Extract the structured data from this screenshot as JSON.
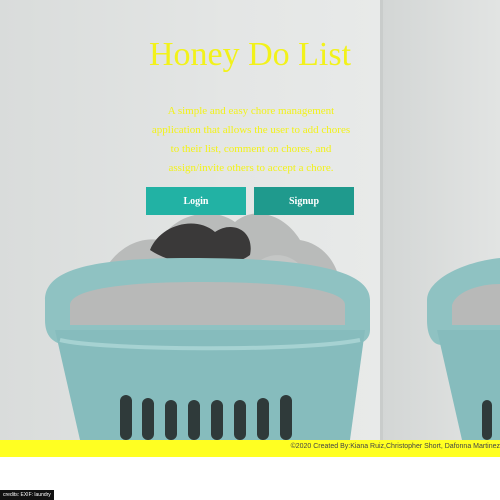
{
  "app": {
    "title": "Honey Do List",
    "description": "A simple and easy chore management application that allows the user to add chores to their list, comment on chores, and assign/invite others to accept a chore."
  },
  "actions": {
    "login_label": "Login",
    "signup_label": "Signup"
  },
  "footer": {
    "text": "©2020 Created By:Kiana Ruiz,Christopher Short, Dafonna Martinez"
  },
  "credit": {
    "text": "credits: EXIF: laundry"
  },
  "colors": {
    "title": "#f2f21a",
    "button_login": "#22b2a4",
    "button_signup": "#1f9a8d",
    "footer": "#ffff22"
  }
}
